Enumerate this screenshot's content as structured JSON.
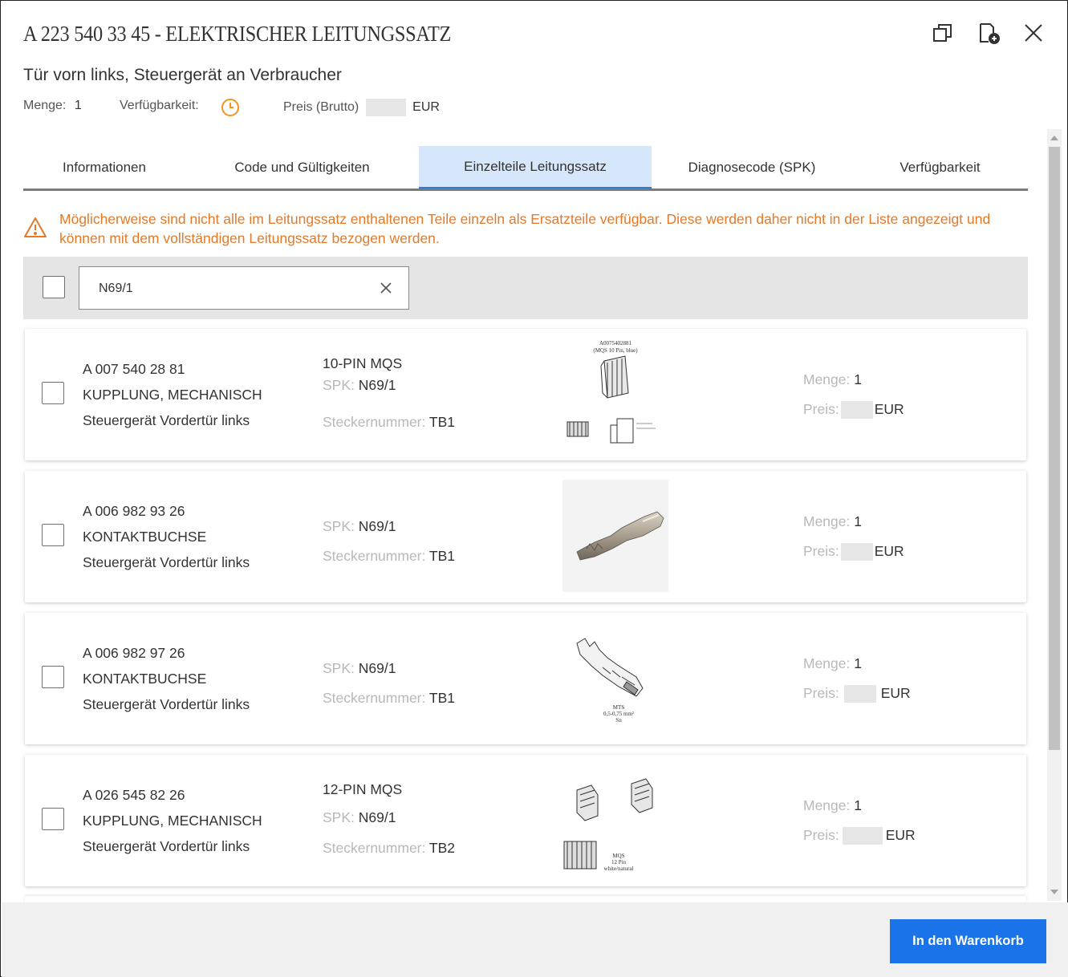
{
  "header": {
    "title": "A 223 540 33 45 - ELEKTRISCHER LEITUNGSSATZ",
    "subtitle": "Tür vorn links, Steuergerät an Verbraucher",
    "menge_label": "Menge:",
    "menge_value": "1",
    "availability_label": "Verfügbarkeit:",
    "price_label": "Preis (Brutto)",
    "price_currency": "EUR",
    "icons": [
      "restore-window-icon",
      "add-document-icon",
      "close-icon"
    ]
  },
  "tabs": [
    {
      "label": "Informationen"
    },
    {
      "label": "Code und Gültigkeiten"
    },
    {
      "label": "Einzelteile Leitungssatz",
      "active": true
    },
    {
      "label": "Diagnosecode (SPK)"
    },
    {
      "label": "Verfügbarkeit"
    }
  ],
  "warning": "Möglicherweise sind nicht alle im Leitungssatz enthaltenen Teile einzeln als Ersatzteile verfügbar. Diese werden daher nicht in der Liste angezeigt und können mit dem vollständigen Leitungssatz bezogen werden.",
  "filter": {
    "search_value": "N69/1"
  },
  "labels": {
    "spk": "SPK:",
    "stecker": "Steckernummer:",
    "menge": "Menge:",
    "preis": "Preis:",
    "currency": "EUR"
  },
  "items": [
    {
      "part_no": "A 007 540 28 81",
      "name": "KUPPLUNG, MECHANISCH",
      "location": "Steuergerät Vordertür links",
      "type": "10-PIN MQS",
      "spk": "N69/1",
      "stecker": "TB1",
      "menge": "1",
      "image_caption_top": "A0075402881",
      "image_caption_sub": "(MQS 10 Pin, blue)"
    },
    {
      "part_no": "A 006 982 93 26",
      "name": "KONTAKTBUCHSE",
      "location": "Steuergerät Vordertür links",
      "type": "",
      "spk": "N69/1",
      "stecker": "TB1",
      "menge": "1"
    },
    {
      "part_no": "A 006 982 97 26",
      "name": "KONTAKTBUCHSE",
      "location": "Steuergerät Vordertür links",
      "type": "",
      "spk": "N69/1",
      "stecker": "TB1",
      "menge": "1",
      "image_caption_1": "MTS",
      "image_caption_2": "0,5-0,75 mm²",
      "image_caption_3": "Sn"
    },
    {
      "part_no": "A 026 545 82 26",
      "name": "KUPPLUNG, MECHANISCH",
      "location": "Steuergerät Vordertür links",
      "type": "12-PIN MQS",
      "spk": "N69/1",
      "stecker": "TB2",
      "menge": "1",
      "image_caption_1": "MQS",
      "image_caption_2": "12 Pin",
      "image_caption_3": "white/natural"
    }
  ],
  "footer": {
    "cart_button": "In den Warenkorb"
  },
  "colors": {
    "warning": "#e27a2a",
    "active_tab": "#d6e6fb",
    "button": "#1a73e8"
  }
}
